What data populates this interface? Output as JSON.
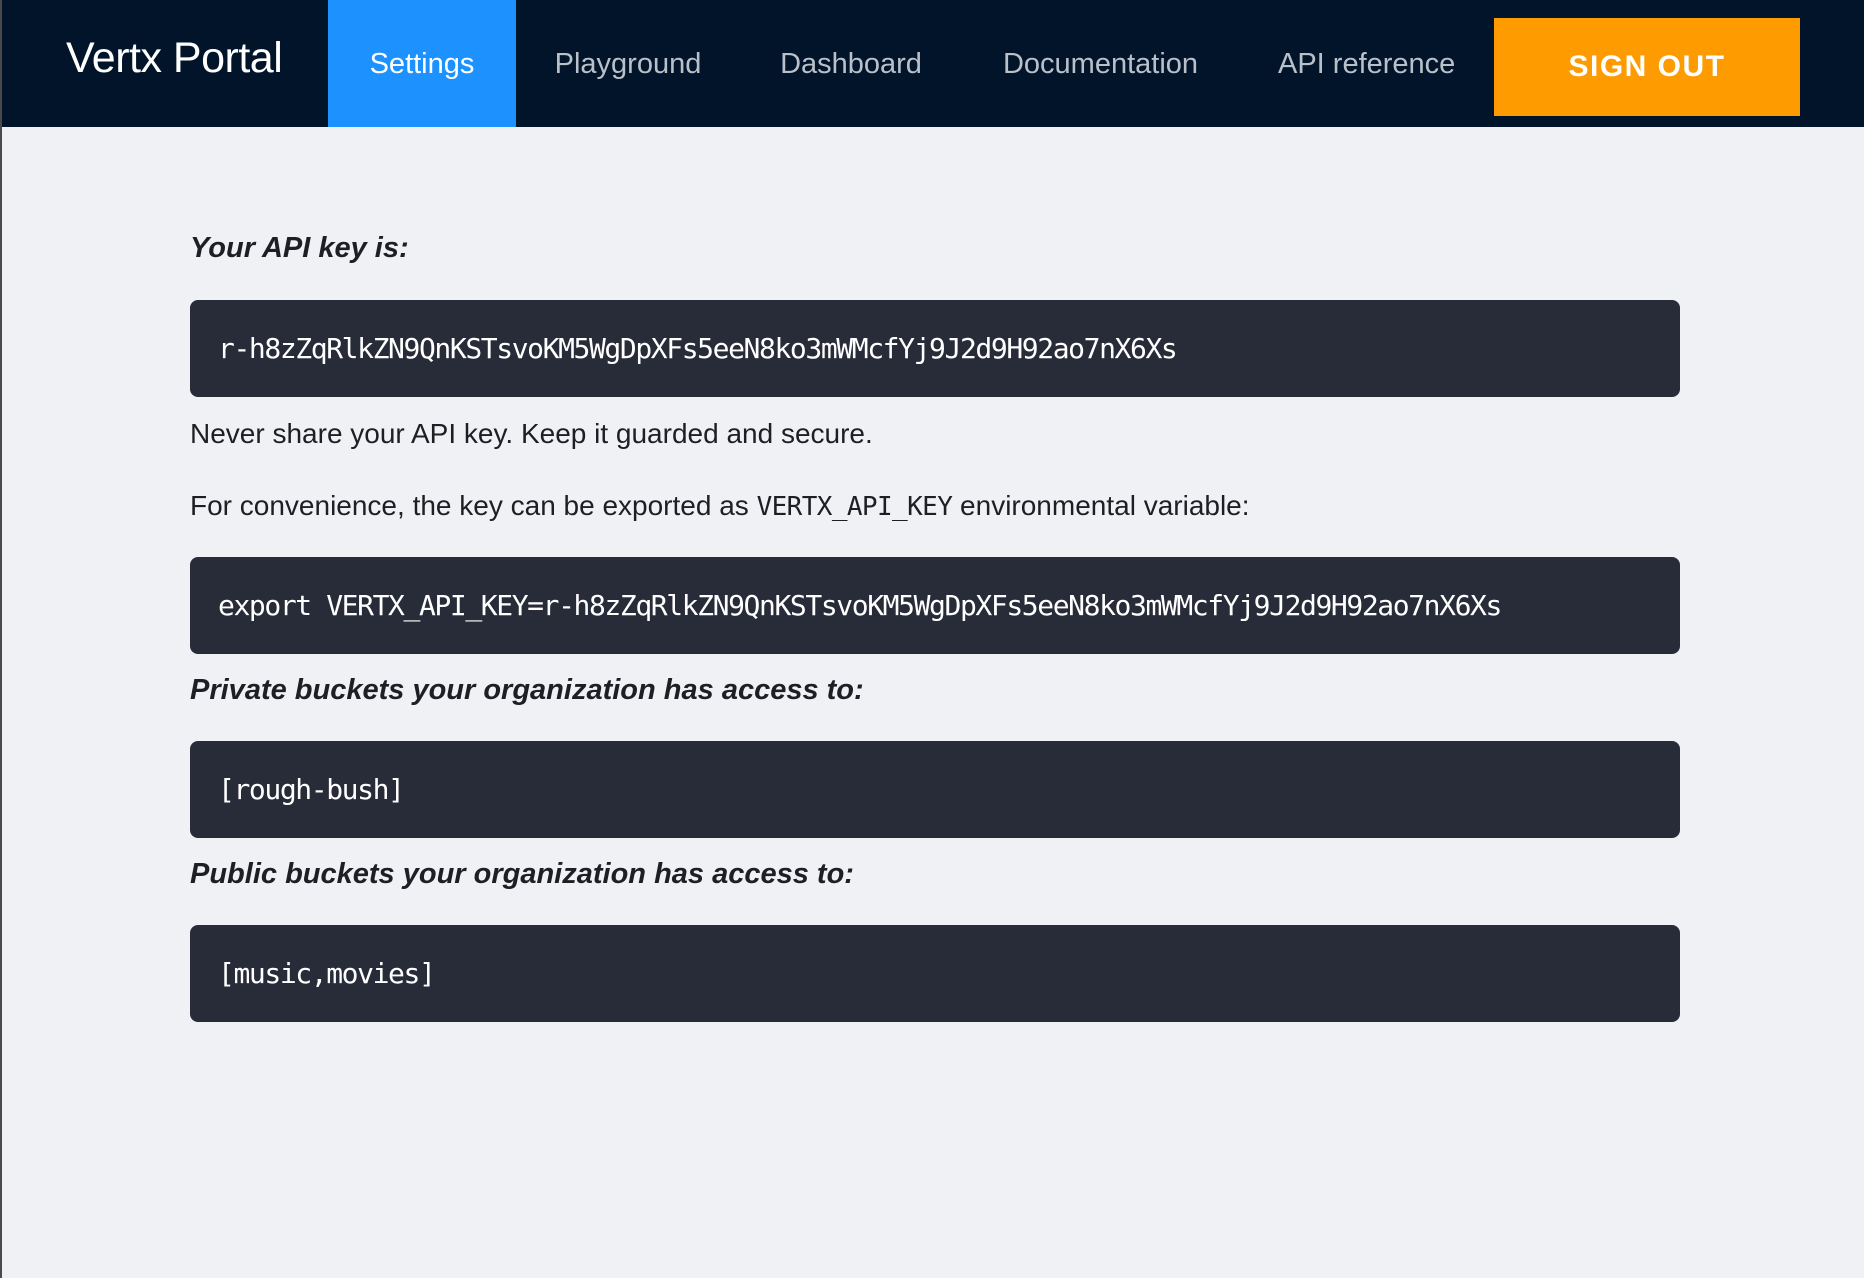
{
  "brand": "Vertx Portal",
  "nav": {
    "tabs": [
      {
        "label": "Settings",
        "active": true
      },
      {
        "label": "Playground",
        "active": false
      },
      {
        "label": "Dashboard",
        "active": false
      },
      {
        "label": "Documentation",
        "active": false
      },
      {
        "label": "API reference",
        "active": false
      }
    ],
    "signout_label": "SIGN OUT"
  },
  "colors": {
    "navbar": "#01142a",
    "active_tab": "#1d92ff",
    "signout": "#fd9b00",
    "code_background": "#282b38",
    "page_background": "#f0f1f4"
  },
  "settings": {
    "api_key_heading": "Your API key is:",
    "api_key": "r-h8zZqRlkZN9QnKSTsvoKM5WgDpXFs5eeN8ko3mWMcfYj9J2d9H92ao7nX6Xs",
    "warning": "Never share your API key. Keep it guarded and secure.",
    "export_note_before": "For convenience, the key can be exported as ",
    "export_note_var": "VERTX_API_KEY",
    "export_note_after": " environmental variable:",
    "export_command": "export VERTX_API_KEY=r-h8zZqRlkZN9QnKSTsvoKM5WgDpXFs5eeN8ko3mWMcfYj9J2d9H92ao7nX6Xs",
    "private_heading": "Private buckets your organization has access to:",
    "private_buckets": "[rough-bush]",
    "public_heading": "Public buckets your organization has access to:",
    "public_buckets": "[music,movies]"
  }
}
